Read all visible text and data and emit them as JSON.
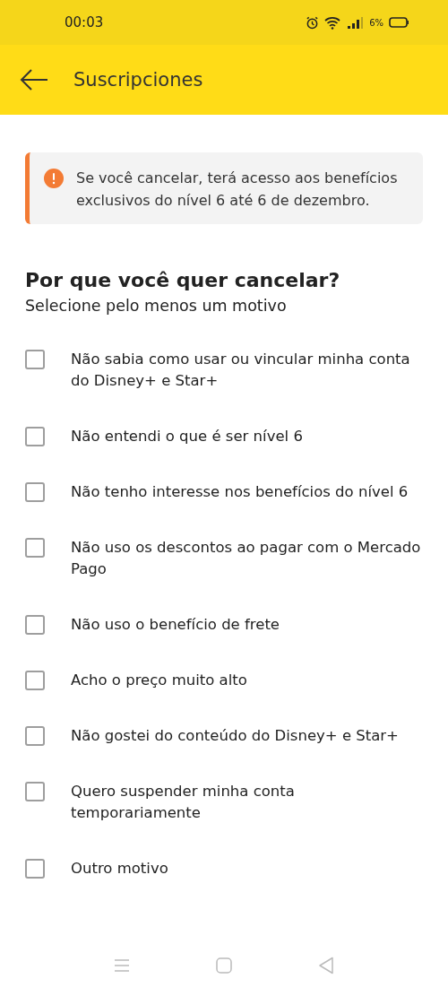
{
  "status_bar": {
    "time": "00:03",
    "battery": "6%"
  },
  "app_bar": {
    "title": "Suscripciones"
  },
  "notice": {
    "text": "Se você cancelar, terá acesso aos benefícios exclusivos do nível 6 até 6 de dezembro."
  },
  "heading": "Por que você quer cancelar?",
  "subtitle": "Selecione pelo menos um motivo",
  "reasons": [
    {
      "label": "Não sabia como usar ou vincular minha conta do Disney+ e Star+",
      "checked": false
    },
    {
      "label": "Não entendi o que é ser nível 6",
      "checked": false
    },
    {
      "label": "Não tenho interesse nos benefícios do nível 6",
      "checked": false
    },
    {
      "label": "Não uso os descontos ao pagar com o Mercado Pago",
      "checked": false
    },
    {
      "label": "Não uso o benefício de frete",
      "checked": false
    },
    {
      "label": "Acho o preço muito alto",
      "checked": false
    },
    {
      "label": "Não gostei do conteúdo do Disney+ e Star+",
      "checked": false
    },
    {
      "label": "Quero suspender minha conta temporariamente",
      "checked": false
    },
    {
      "label": "Outro motivo",
      "checked": false
    }
  ]
}
